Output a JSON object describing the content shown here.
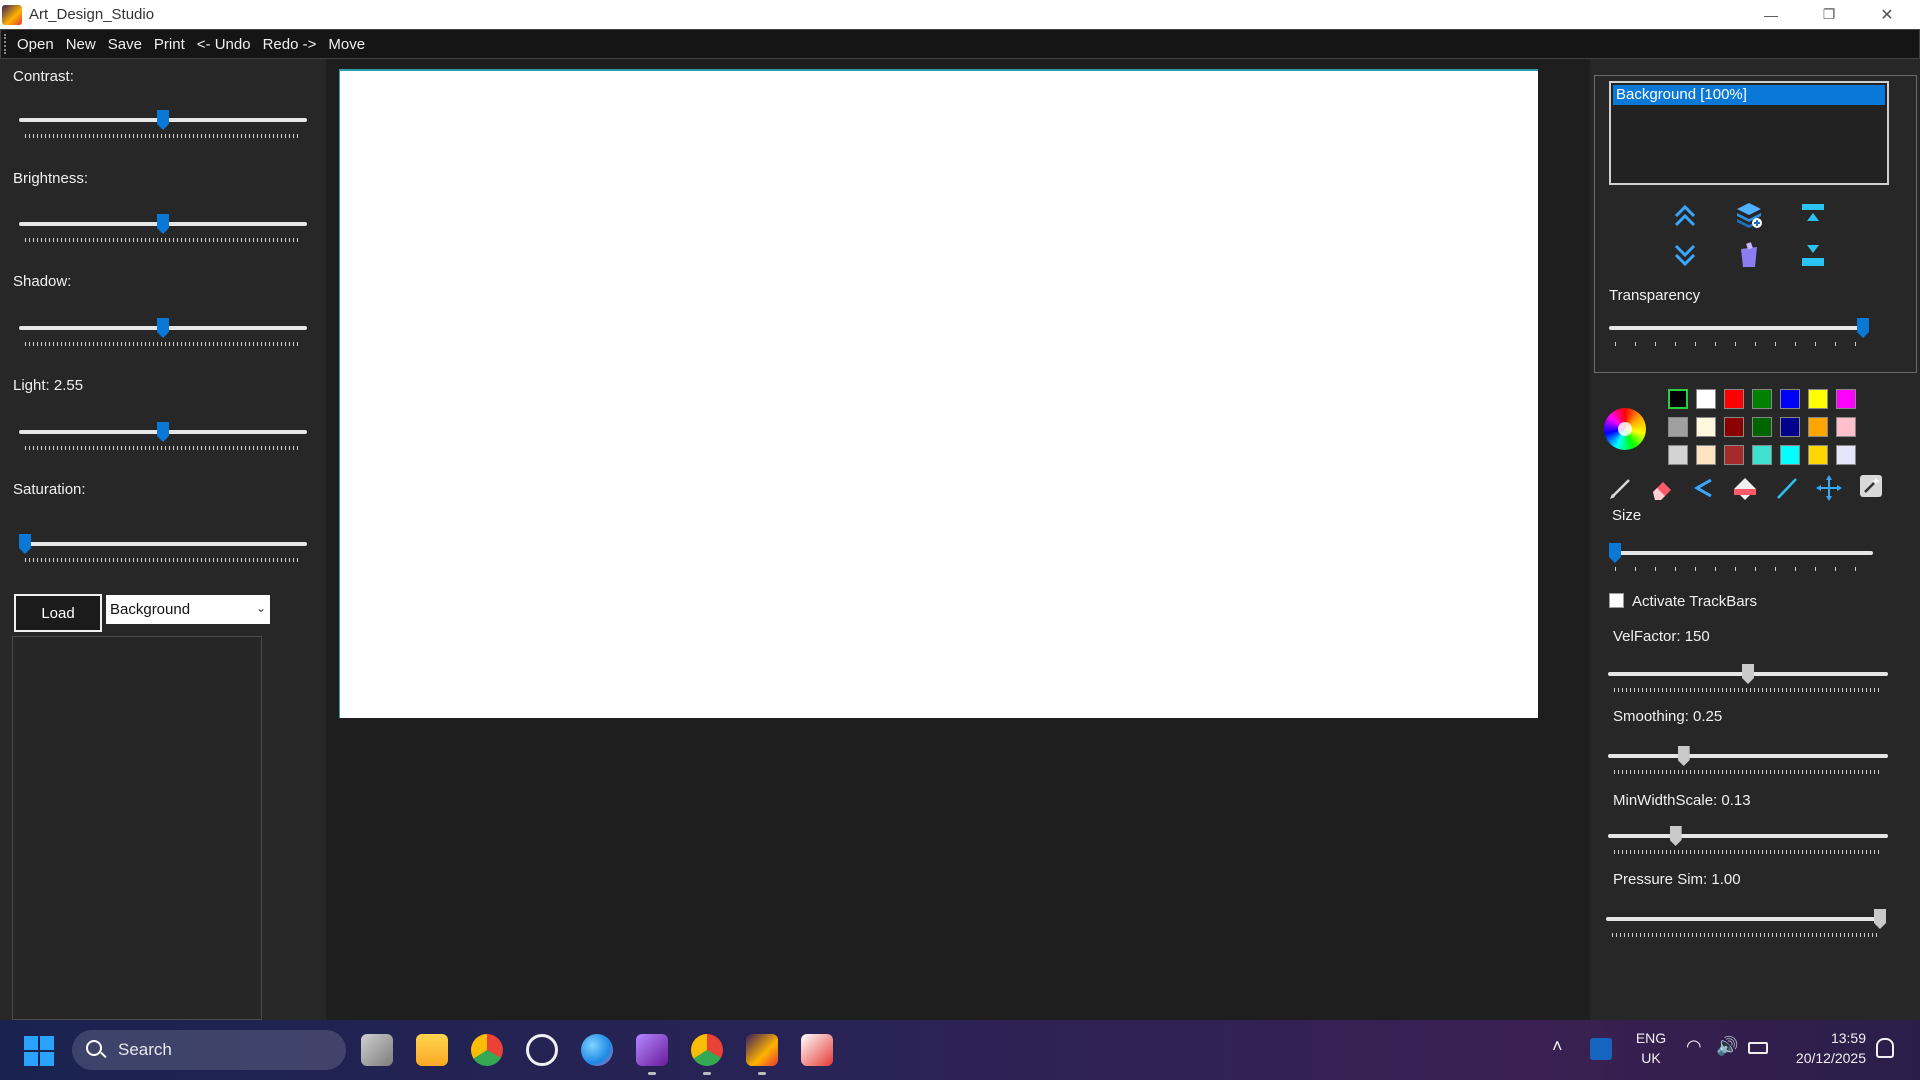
{
  "window": {
    "title": "Art_Design_Studio"
  },
  "menu": {
    "items": [
      {
        "label": "Open"
      },
      {
        "label": "New"
      },
      {
        "label": "Save"
      },
      {
        "label": "Print"
      },
      {
        "label": "<- Undo"
      },
      {
        "label": "Redo ->"
      },
      {
        "label": "Move"
      }
    ]
  },
  "left_panel": {
    "adjustments": [
      {
        "label": "Contrast:",
        "value": 0.5
      },
      {
        "label": "Brightness:",
        "value": 0.5
      },
      {
        "label": "Shadow:",
        "value": 0.5
      },
      {
        "label": "Light: 2.55",
        "value": 0.5
      },
      {
        "label": "Saturation:",
        "value": 0.0
      }
    ],
    "load_label": "Load",
    "layer_select_value": "Background"
  },
  "right_panel": {
    "layers": [
      {
        "label": "Background [100%]"
      }
    ],
    "transparency_label": "Transparency",
    "transparency_value": 1.0,
    "size_label": "Size",
    "size_value": 0.0,
    "palette": [
      [
        "#000000",
        "#ffffff",
        "#ff0000",
        "#008000",
        "#0000ff",
        "#ffff00",
        "#ff00ff"
      ],
      [
        "#a0a0a0",
        "#fff8dc",
        "#8b0000",
        "#006400",
        "#00008b",
        "#ffa500",
        "#ffc0cb"
      ],
      [
        "#d3d3d3",
        "#ffe4c4",
        "#a52a2a",
        "#40e0d0",
        "#00ffff",
        "#ffd700",
        "#e6e6fa"
      ]
    ],
    "activate_trackbars_label": "Activate TrackBars",
    "trackbars": [
      {
        "label": "VelFactor: 150",
        "value": 0.5
      },
      {
        "label": "Smoothing: 0.25",
        "value": 0.26
      },
      {
        "label": "MinWidthScale: 0.13",
        "value": 0.23
      },
      {
        "label": "Pressure Sim: 1.00",
        "value": 1.0
      }
    ]
  },
  "taskbar": {
    "search_label": "Search",
    "language": "ENG",
    "region": "UK",
    "time": "13:59",
    "date": "20/12/2025"
  },
  "colors": {
    "accent": "#0a78d7",
    "canvas_border": "#2b9da6"
  }
}
